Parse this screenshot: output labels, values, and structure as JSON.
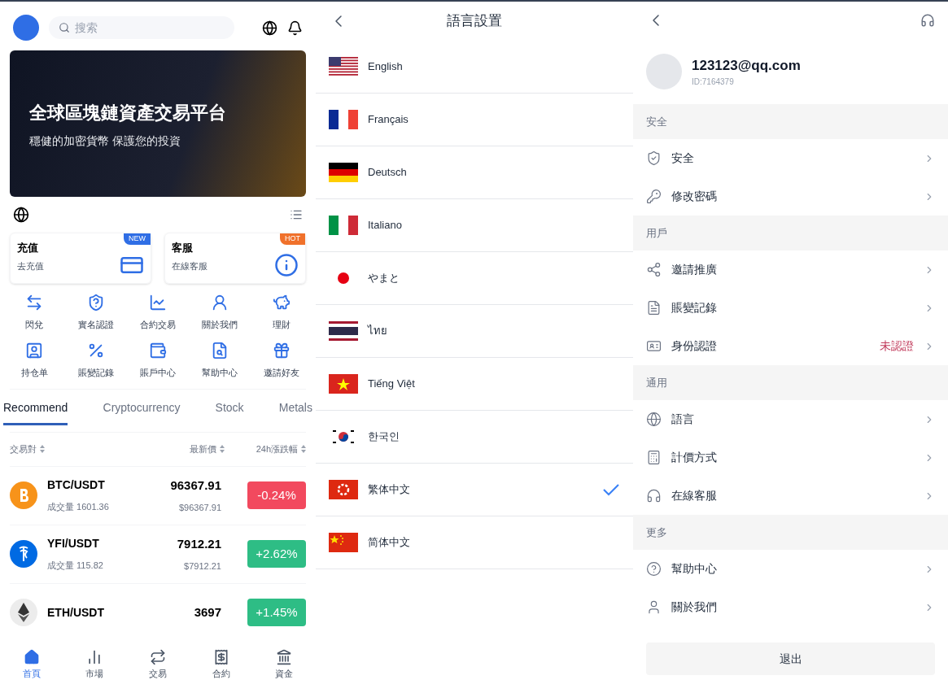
{
  "home": {
    "search": {
      "placeholder": "搜索"
    },
    "banner": {
      "title": "全球區塊鏈資產交易平台",
      "subtitle": "穩健的加密貨幣 保護您的投資"
    },
    "cards": [
      {
        "title": "充值",
        "subtitle": "去充值",
        "badge": {
          "text": "NEW",
          "kind": "new"
        }
      },
      {
        "title": "客服",
        "subtitle": "在線客服",
        "badge": {
          "text": "HOT",
          "kind": "hot"
        }
      }
    ],
    "shortcuts": [
      "閃兌",
      "實名認證",
      "合約交易",
      "關於我們",
      "理財",
      "持仓单",
      "賬變記錄",
      "賬戶中心",
      "幫助中心",
      "邀請好友"
    ],
    "tabs": [
      {
        "label": "Recommend",
        "selected": true
      },
      {
        "label": "Cryptocurrency",
        "selected": false
      },
      {
        "label": "Stock",
        "selected": false
      },
      {
        "label": "Metals",
        "selected": false
      }
    ],
    "table": {
      "columns": [
        "交易對",
        "最新價",
        "24h漲跌幅"
      ],
      "rows": [
        {
          "pair": "BTC/USDT",
          "volume": "成交量 1601.36",
          "price": "96367.91",
          "usd": "$96367.91",
          "change": "-0.24%",
          "kind": "down"
        },
        {
          "pair": "YFI/USDT",
          "volume": "成交量 115.82",
          "price": "7912.21",
          "usd": "$7912.21",
          "change": "+2.62%",
          "kind": "up"
        },
        {
          "pair": "ETH/USDT",
          "price": "3697",
          "change": "+1.45%",
          "kind": "up"
        }
      ]
    },
    "nav": [
      {
        "label": "首頁",
        "selected": true
      },
      {
        "label": "市場",
        "selected": false
      },
      {
        "label": "交易",
        "selected": false
      },
      {
        "label": "合約",
        "selected": false
      },
      {
        "label": "資金",
        "selected": false
      }
    ]
  },
  "language": {
    "title": "語言設置",
    "items": [
      {
        "label": "English",
        "kind": "us",
        "selected": false
      },
      {
        "label": "Français",
        "kind": "fr",
        "selected": false
      },
      {
        "label": "Deutsch",
        "kind": "de",
        "selected": false
      },
      {
        "label": "Italiano",
        "kind": "it",
        "selected": false
      },
      {
        "label": "やまと",
        "kind": "jp",
        "selected": false
      },
      {
        "label": "ไทย",
        "kind": "th",
        "selected": false
      },
      {
        "label": "Tiếng Việt",
        "kind": "vn",
        "selected": false
      },
      {
        "label": "한국인",
        "kind": "kr",
        "selected": false
      },
      {
        "label": "繁体中文",
        "kind": "hk",
        "selected": true
      },
      {
        "label": "简体中文",
        "kind": "cn",
        "selected": false
      }
    ]
  },
  "profile": {
    "email": "123123@qq.com",
    "id": "ID:7164379",
    "sections": [
      {
        "title": "安全",
        "items": [
          {
            "label": "安全"
          },
          {
            "label": "修改密碼"
          }
        ]
      },
      {
        "title": "用戶",
        "items": [
          {
            "label": "邀請推廣"
          },
          {
            "label": "賬變記錄"
          },
          {
            "label": "身份認證",
            "status": "未認證"
          }
        ]
      },
      {
        "title": "通用",
        "items": [
          {
            "label": "語言"
          },
          {
            "label": "計價方式"
          },
          {
            "label": "在線客服"
          }
        ]
      },
      {
        "title": "更多",
        "items": [
          {
            "label": "幫助中心"
          },
          {
            "label": "關於我們"
          }
        ]
      }
    ],
    "logout": "退出"
  }
}
